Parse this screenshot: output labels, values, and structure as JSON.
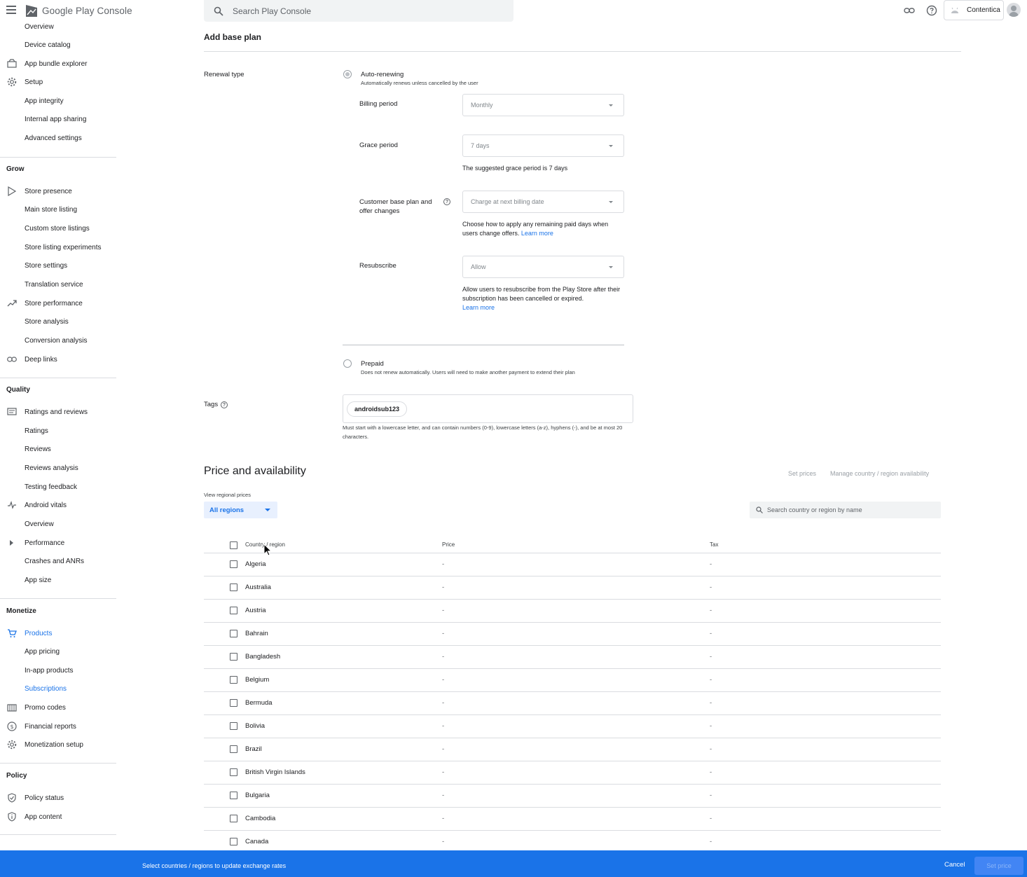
{
  "app": {
    "title": "Google Play Console",
    "account": "Contentica"
  },
  "search": {
    "placeholder": "Search Play Console"
  },
  "sidebar": {
    "items": [
      {
        "label": "Overview",
        "kind": "sub"
      },
      {
        "label": "Device catalog",
        "kind": "sub"
      },
      {
        "label": "App bundle explorer",
        "kind": "top",
        "icon": "bundle-icon"
      },
      {
        "label": "Setup",
        "kind": "top",
        "icon": "gear-icon"
      },
      {
        "label": "App integrity",
        "kind": "sub"
      },
      {
        "label": "Internal app sharing",
        "kind": "sub"
      },
      {
        "label": "Advanced settings",
        "kind": "sub"
      },
      {
        "label": "Store presence",
        "kind": "top",
        "icon": "play-icon"
      },
      {
        "label": "Main store listing",
        "kind": "sub"
      },
      {
        "label": "Custom store listings",
        "kind": "sub"
      },
      {
        "label": "Store listing experiments",
        "kind": "sub"
      },
      {
        "label": "Store settings",
        "kind": "sub"
      },
      {
        "label": "Translation service",
        "kind": "sub"
      },
      {
        "label": "Store performance",
        "kind": "top",
        "icon": "trending-icon"
      },
      {
        "label": "Store analysis",
        "kind": "sub"
      },
      {
        "label": "Conversion analysis",
        "kind": "sub"
      },
      {
        "label": "Deep links",
        "kind": "top",
        "icon": "link-icon"
      },
      {
        "label": "Ratings and reviews",
        "kind": "top",
        "icon": "reviews-icon"
      },
      {
        "label": "Ratings",
        "kind": "sub"
      },
      {
        "label": "Reviews",
        "kind": "sub"
      },
      {
        "label": "Reviews analysis",
        "kind": "sub"
      },
      {
        "label": "Testing feedback",
        "kind": "sub"
      },
      {
        "label": "Android vitals",
        "kind": "top",
        "icon": "vitals-icon"
      },
      {
        "label": "Overview",
        "kind": "sub"
      },
      {
        "label": "Performance",
        "kind": "sub"
      },
      {
        "label": "Crashes and ANRs",
        "kind": "sub"
      },
      {
        "label": "App size",
        "kind": "sub"
      },
      {
        "label": "Products",
        "kind": "top",
        "icon": "cart-icon"
      },
      {
        "label": "App pricing",
        "kind": "sub"
      },
      {
        "label": "In-app products",
        "kind": "sub"
      },
      {
        "label": "Subscriptions",
        "kind": "sub"
      },
      {
        "label": "Promo codes",
        "kind": "top",
        "icon": "promo-icon"
      },
      {
        "label": "Financial reports",
        "kind": "top",
        "icon": "dollar-icon"
      },
      {
        "label": "Monetization setup",
        "kind": "top",
        "icon": "gear-icon"
      },
      {
        "label": "Policy status",
        "kind": "top",
        "icon": "shield-check-icon"
      },
      {
        "label": "App content",
        "kind": "top",
        "icon": "shield-info-icon"
      }
    ],
    "sections": {
      "grow": "Grow",
      "quality": "Quality",
      "monetize": "Monetize",
      "policy": "Policy"
    },
    "accent_color": "#1a73e8"
  },
  "form": {
    "heading": "Add base plan",
    "renewal_type_label": "Renewal type",
    "auto_renewing": {
      "title": "Auto-renewing",
      "subtitle": "Automatically renews unless cancelled by the user",
      "selected": true
    },
    "billing_period": {
      "label": "Billing period",
      "value": "Monthly"
    },
    "grace_period": {
      "label": "Grace period",
      "value": "7 days",
      "helper": "The suggested grace period is 7 days"
    },
    "base_plan_changes": {
      "label": "Customer base plan and offer changes",
      "value": "Charge at next billing date",
      "helper": "Choose how to apply any remaining paid days when users change offers.",
      "link": "Learn more"
    },
    "resubscribe": {
      "label": "Resubscribe",
      "value": "Allow",
      "helper": "Allow users to resubscribe from the Play Store after their subscription has been cancelled or expired.",
      "link": "Learn more"
    },
    "prepaid": {
      "title": "Prepaid",
      "subtitle": "Does not renew automatically. Users will need to make another payment to extend their plan",
      "selected": false
    },
    "tags": {
      "label": "Tags",
      "chip": "androidsub123",
      "helper": "Must start with a lowercase letter, and can contain numbers (0-9), lowercase letters (a-z), hyphens (-), and be at most 20 characters."
    }
  },
  "pricing": {
    "heading": "Price and availability",
    "set_prices": "Set prices",
    "manage_availability": "Manage country / region availability",
    "view_label": "View regional prices",
    "region_value": "All regions",
    "search_placeholder": "Search country or region by name",
    "columns": {
      "country": "Country / region",
      "price": "Price",
      "tax": "Tax"
    },
    "rows": [
      {
        "country": "Algeria",
        "price": "-",
        "tax": "-"
      },
      {
        "country": "Australia",
        "price": "-",
        "tax": "-"
      },
      {
        "country": "Austria",
        "price": "-",
        "tax": "-"
      },
      {
        "country": "Bahrain",
        "price": "-",
        "tax": "-"
      },
      {
        "country": "Bangladesh",
        "price": "-",
        "tax": "-"
      },
      {
        "country": "Belgium",
        "price": "-",
        "tax": "-"
      },
      {
        "country": "Bermuda",
        "price": "-",
        "tax": "-"
      },
      {
        "country": "Bolivia",
        "price": "-",
        "tax": "-"
      },
      {
        "country": "Brazil",
        "price": "-",
        "tax": "-"
      },
      {
        "country": "British Virgin Islands",
        "price": "-",
        "tax": "-"
      },
      {
        "country": "Bulgaria",
        "price": "-",
        "tax": "-"
      },
      {
        "country": "Cambodia",
        "price": "-",
        "tax": "-"
      },
      {
        "country": "Canada",
        "price": "-",
        "tax": "-"
      }
    ]
  },
  "footer": {
    "message": "Select countries / regions to update exchange rates",
    "cancel": "Cancel",
    "set_price": "Set price",
    "bg_color": "#1a73e8"
  }
}
